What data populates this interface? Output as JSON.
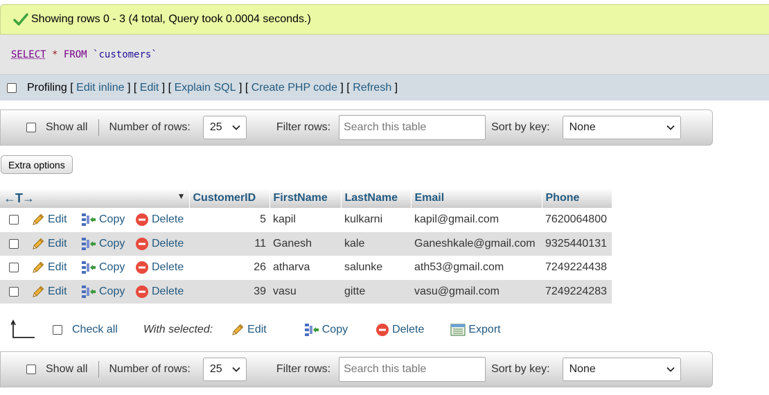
{
  "result": {
    "message": "Showing rows 0 - 3 (4 total, Query took 0.0004 seconds.)"
  },
  "sql": {
    "select": "SELECT",
    "star": "*",
    "from": "FROM",
    "table": "`customers`"
  },
  "profiling": {
    "label": "Profiling",
    "links": [
      "Edit inline",
      "Edit",
      "Explain SQL",
      "Create PHP code",
      "Refresh"
    ]
  },
  "navigation": {
    "show_all": "Show all",
    "rows_label": "Number of rows:",
    "rows_value": "25",
    "filter_label": "Filter rows:",
    "filter_placeholder": "Search this table",
    "sort_label": "Sort by key:",
    "sort_value": "None"
  },
  "extra_options": "Extra options",
  "table": {
    "arrows": "←T→",
    "columns": [
      "CustomerID",
      "FirstName",
      "LastName",
      "Email",
      "Phone"
    ],
    "action_labels": {
      "edit": "Edit",
      "copy": "Copy",
      "delete": "Delete"
    },
    "rows": [
      {
        "CustomerID": "5",
        "FirstName": "kapil",
        "LastName": "kulkarni",
        "Email": "kapil@gmail.com",
        "Phone": "7620064800"
      },
      {
        "CustomerID": "11",
        "FirstName": "Ganesh",
        "LastName": "kale",
        "Email": "Ganeshkale@gmail.com",
        "Phone": "9325440131"
      },
      {
        "CustomerID": "26",
        "FirstName": "atharva",
        "LastName": "salunke",
        "Email": "ath53@gmail.com",
        "Phone": "7249224438"
      },
      {
        "CustomerID": "39",
        "FirstName": "vasu",
        "LastName": "gitte",
        "Email": "vasu@gmail.com",
        "Phone": "7249224283"
      }
    ]
  },
  "bulk": {
    "check_all": "Check all",
    "with_selected": "With selected:",
    "edit": "Edit",
    "copy": "Copy",
    "delete": "Delete",
    "export": "Export"
  },
  "icons": {
    "success": "check-icon",
    "edit": "pencil-icon",
    "copy": "copy-icon",
    "delete": "delete-icon",
    "export": "export-icon",
    "up_arrow": "arrow-up-icon"
  },
  "colors": {
    "success_bg": "#ebf8a4",
    "link": "#235a81",
    "delete_red": "#e84a3c",
    "row_even": "#dfdfdf"
  }
}
